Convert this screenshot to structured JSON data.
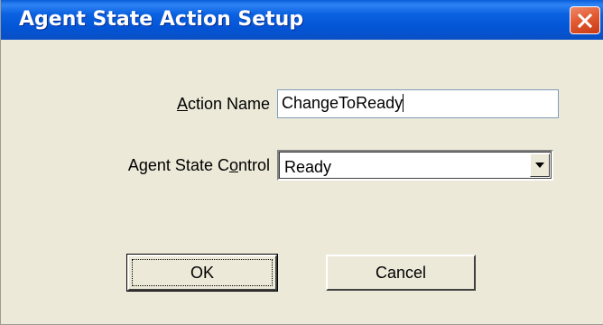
{
  "window": {
    "title": "Agent State Action Setup",
    "close_icon": "close-icon",
    "close_color": "#E25B32",
    "titlebar_color": "#0355D6"
  },
  "form": {
    "action_name": {
      "label_pre": "",
      "label_mnemonic": "A",
      "label_post": "ction Name",
      "value": "ChangeToReady"
    },
    "agent_state_control": {
      "label_pre": "Agent State C",
      "label_mnemonic": "o",
      "label_post": "ntrol",
      "selected": "Ready",
      "dropdown_icon": "chevron-down-icon"
    }
  },
  "buttons": {
    "ok_label": "OK",
    "cancel_label": "Cancel"
  }
}
